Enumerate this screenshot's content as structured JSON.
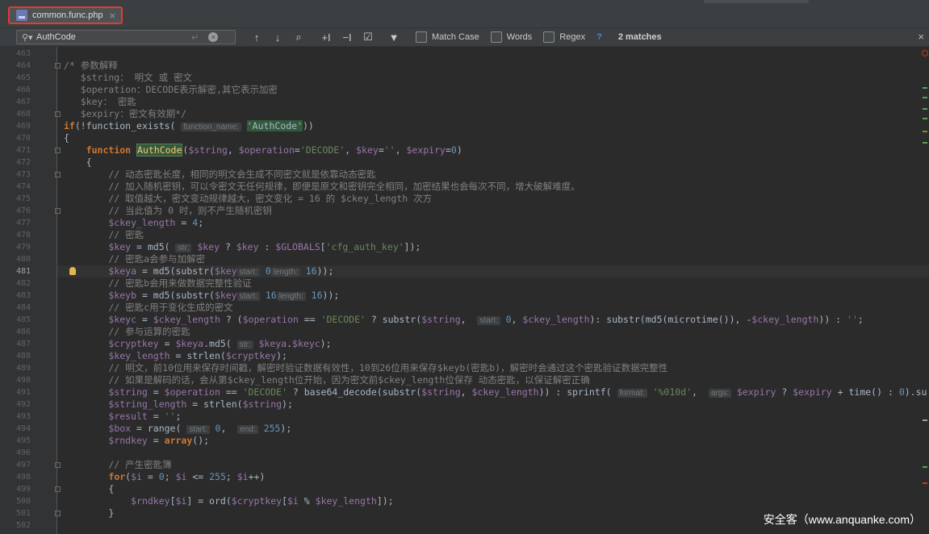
{
  "tab": {
    "filename": "common.func.php",
    "close": "×"
  },
  "find": {
    "query": "AuthCode",
    "enter_glyph": "↵",
    "match_case_label": "Match Case",
    "words_label": "Words",
    "regex_label": "Regex",
    "help": "?",
    "matches": "2 matches",
    "close": "×"
  },
  "editor": {
    "current_line": 481,
    "lines": [
      {
        "n": "463",
        "t": []
      },
      {
        "n": "464",
        "fold": true,
        "t": [
          [
            "cm",
            "/* 参数解释"
          ]
        ]
      },
      {
        "n": "465",
        "t": [
          [
            "cm",
            "   $string： 明文 或 密文"
          ]
        ]
      },
      {
        "n": "466",
        "t": [
          [
            "cm",
            "   $operation：DECODE表示解密,其它表示加密"
          ]
        ]
      },
      {
        "n": "467",
        "t": [
          [
            "cm",
            "   $key： 密匙"
          ]
        ]
      },
      {
        "n": "468",
        "fold": true,
        "t": [
          [
            "cm",
            "   $expiry：密文有效期*/"
          ]
        ]
      },
      {
        "n": "469",
        "t": [
          [
            "kw",
            "if"
          ],
          [
            "",
            "(!function_exists( "
          ],
          [
            "hint",
            "function_name:"
          ],
          [
            "",
            " "
          ],
          [
            "fnmatch",
            "'AuthCode'"
          ],
          [
            "",
            "))"
          ]
        ]
      },
      {
        "n": "470",
        "t": [
          [
            "",
            "{"
          ]
        ]
      },
      {
        "n": "471",
        "fold": true,
        "t": [
          [
            "",
            "    "
          ],
          [
            "kw",
            "function "
          ],
          [
            "fnmatch2",
            "AuthCode"
          ],
          [
            "",
            "("
          ],
          [
            "var",
            "$string"
          ],
          [
            "",
            ", "
          ],
          [
            "var",
            "$operation"
          ],
          [
            "",
            "="
          ],
          [
            "str",
            "'DECODE'"
          ],
          [
            "",
            ", "
          ],
          [
            "var",
            "$key"
          ],
          [
            "",
            "="
          ],
          [
            "str",
            "''"
          ],
          [
            "",
            ", "
          ],
          [
            "var",
            "$expiry"
          ],
          [
            "",
            "="
          ],
          [
            "num",
            "0"
          ],
          [
            "",
            ")"
          ]
        ]
      },
      {
        "n": "472",
        "t": [
          [
            "",
            "    {"
          ]
        ]
      },
      {
        "n": "473",
        "fold": true,
        "t": [
          [
            "cm",
            "        // 动态密匙长度，相同的明文会生成不同密文就是依靠动态密匙"
          ]
        ]
      },
      {
        "n": "474",
        "t": [
          [
            "cm",
            "        // 加入随机密钥，可以令密文无任何规律，即便是原文和密钥完全相同，加密结果也会每次不同，增大破解难度。"
          ]
        ]
      },
      {
        "n": "475",
        "t": [
          [
            "cm",
            "        // 取值越大，密文变动规律越大，密文变化 = 16 的 $ckey_length 次方"
          ]
        ]
      },
      {
        "n": "476",
        "fold": true,
        "t": [
          [
            "cm",
            "        // 当此值为 0 时，则不产生随机密钥"
          ]
        ]
      },
      {
        "n": "477",
        "t": [
          [
            "",
            "        "
          ],
          [
            "var",
            "$ckey_length"
          ],
          [
            "",
            " = "
          ],
          [
            "num",
            "4"
          ],
          [
            "",
            ";"
          ]
        ]
      },
      {
        "n": "478",
        "t": [
          [
            "cm",
            "        // 密匙"
          ]
        ]
      },
      {
        "n": "479",
        "t": [
          [
            "",
            "        "
          ],
          [
            "var",
            "$key"
          ],
          [
            "",
            " = md5( "
          ],
          [
            "hint",
            "str:"
          ],
          [
            "",
            " "
          ],
          [
            "var",
            "$key"
          ],
          [
            "",
            " ? "
          ],
          [
            "var",
            "$key"
          ],
          [
            "",
            " : "
          ],
          [
            "var",
            "$GLOBALS"
          ],
          [
            "",
            "["
          ],
          [
            "str",
            "'cfg_auth_key'"
          ],
          [
            "",
            "]);"
          ]
        ]
      },
      {
        "n": "480",
        "t": [
          [
            "cm",
            "        // 密匙a会参与加解密"
          ]
        ]
      },
      {
        "n": "481",
        "bulb": true,
        "t": [
          [
            "",
            "        "
          ],
          [
            "var",
            "$keya"
          ],
          [
            "",
            " = md5(substr("
          ],
          [
            "var",
            "$key"
          ],
          [
            ",  "
          ],
          [
            "hint",
            "start:"
          ],
          [
            "",
            " "
          ],
          [
            "num",
            "0"
          ],
          [
            ",  "
          ],
          [
            "hint",
            "length:"
          ],
          [
            "",
            " "
          ],
          [
            "num",
            "16"
          ],
          [
            "",
            "));"
          ]
        ]
      },
      {
        "n": "482",
        "t": [
          [
            "cm",
            "        // 密匙b会用来做数据完整性验证"
          ]
        ]
      },
      {
        "n": "483",
        "t": [
          [
            "",
            "        "
          ],
          [
            "var",
            "$keyb"
          ],
          [
            "",
            " = md5(substr("
          ],
          [
            "var",
            "$key"
          ],
          [
            ",  "
          ],
          [
            "hint",
            "start:"
          ],
          [
            "",
            " "
          ],
          [
            "num",
            "16"
          ],
          [
            ",  "
          ],
          [
            "hint",
            "length:"
          ],
          [
            "",
            " "
          ],
          [
            "num",
            "16"
          ],
          [
            "",
            "));"
          ]
        ]
      },
      {
        "n": "484",
        "t": [
          [
            "cm",
            "        // 密匙c用于变化生成的密文"
          ]
        ]
      },
      {
        "n": "485",
        "t": [
          [
            "",
            "        "
          ],
          [
            "var",
            "$keyc"
          ],
          [
            "",
            " = "
          ],
          [
            "var",
            "$ckey_length"
          ],
          [
            "",
            " ? ("
          ],
          [
            "var",
            "$operation"
          ],
          [
            "",
            " == "
          ],
          [
            "str",
            "'DECODE'"
          ],
          [
            "",
            " ? substr("
          ],
          [
            "var",
            "$string"
          ],
          [
            "",
            ",  "
          ],
          [
            "hint",
            "start:"
          ],
          [
            "",
            " "
          ],
          [
            "num",
            "0"
          ],
          [
            "",
            ", "
          ],
          [
            "var",
            "$ckey_length"
          ],
          [
            "",
            "): substr(md5(microtime()), -"
          ],
          [
            "var",
            "$ckey_length"
          ],
          [
            "",
            ")) : "
          ],
          [
            "str",
            "''"
          ],
          [
            "",
            ";"
          ]
        ]
      },
      {
        "n": "486",
        "t": [
          [
            "cm",
            "        // 参与运算的密匙"
          ]
        ]
      },
      {
        "n": "487",
        "t": [
          [
            "",
            "        "
          ],
          [
            "var",
            "$cryptkey"
          ],
          [
            "",
            " = "
          ],
          [
            "var",
            "$keya"
          ],
          [
            "",
            ".md5( "
          ],
          [
            "hint",
            "str:"
          ],
          [
            "",
            " "
          ],
          [
            "var",
            "$keya"
          ],
          [
            "",
            "."
          ],
          [
            "var",
            "$keyc"
          ],
          [
            "",
            ");"
          ]
        ]
      },
      {
        "n": "488",
        "t": [
          [
            "",
            "        "
          ],
          [
            "var",
            "$key_length"
          ],
          [
            "",
            " = strlen("
          ],
          [
            "var",
            "$cryptkey"
          ],
          [
            "",
            ");"
          ]
        ]
      },
      {
        "n": "489",
        "t": [
          [
            "cm",
            "        // 明文，前10位用来保存时间戳，解密时验证数据有效性，10到26位用来保存$keyb(密匙b)，解密时会通过这个密匙验证数据完整性"
          ]
        ]
      },
      {
        "n": "490",
        "t": [
          [
            "cm",
            "        // 如果是解码的话，会从第$ckey_length位开始，因为密文前$ckey_length位保存 动态密匙，以保证解密正确"
          ]
        ]
      },
      {
        "n": "491",
        "t": [
          [
            "",
            "        "
          ],
          [
            "var",
            "$string"
          ],
          [
            "",
            " = "
          ],
          [
            "var",
            "$operation"
          ],
          [
            "",
            " == "
          ],
          [
            "str",
            "'DECODE'"
          ],
          [
            "",
            " ? base64_decode(substr("
          ],
          [
            "var",
            "$string"
          ],
          [
            "",
            ", "
          ],
          [
            "var",
            "$ckey_length"
          ],
          [
            "",
            ")) : sprintf( "
          ],
          [
            "hint",
            "format:"
          ],
          [
            "",
            " "
          ],
          [
            "str",
            "'%010d'"
          ],
          [
            "",
            ",  "
          ],
          [
            "hint",
            "args:"
          ],
          [
            "",
            " "
          ],
          [
            "var",
            "$expiry"
          ],
          [
            "",
            " ? "
          ],
          [
            "var",
            "$expiry"
          ],
          [
            "",
            " + time() : "
          ],
          [
            "num",
            "0"
          ],
          [
            "",
            ").su"
          ]
        ]
      },
      {
        "n": "492",
        "t": [
          [
            "",
            "        "
          ],
          [
            "var",
            "$string_length"
          ],
          [
            "",
            " = strlen("
          ],
          [
            "var",
            "$string"
          ],
          [
            "",
            ");"
          ]
        ]
      },
      {
        "n": "493",
        "t": [
          [
            "",
            "        "
          ],
          [
            "var",
            "$result"
          ],
          [
            "",
            " = "
          ],
          [
            "str",
            "''"
          ],
          [
            "",
            ";"
          ]
        ]
      },
      {
        "n": "494",
        "t": [
          [
            "",
            "        "
          ],
          [
            "var",
            "$box"
          ],
          [
            "",
            " = range( "
          ],
          [
            "hint",
            "start:"
          ],
          [
            "",
            " "
          ],
          [
            "num",
            "0"
          ],
          [
            "",
            ",  "
          ],
          [
            "hint",
            "end:"
          ],
          [
            "",
            " "
          ],
          [
            "num",
            "255"
          ],
          [
            "",
            ");"
          ]
        ]
      },
      {
        "n": "495",
        "t": [
          [
            "",
            "        "
          ],
          [
            "var",
            "$rndkey"
          ],
          [
            "",
            " = "
          ],
          [
            "kw",
            "array"
          ],
          [
            "",
            "();"
          ]
        ]
      },
      {
        "n": "496",
        "t": []
      },
      {
        "n": "497",
        "fold": true,
        "t": [
          [
            "cm",
            "        // 产生密匙簿"
          ]
        ]
      },
      {
        "n": "498",
        "t": [
          [
            "",
            "        "
          ],
          [
            "kw",
            "for"
          ],
          [
            "",
            "("
          ],
          [
            "var",
            "$i"
          ],
          [
            "",
            " = "
          ],
          [
            "num",
            "0"
          ],
          [
            "",
            "; "
          ],
          [
            "var",
            "$i"
          ],
          [
            "",
            " <= "
          ],
          [
            "num",
            "255"
          ],
          [
            "",
            "; "
          ],
          [
            "var",
            "$i"
          ],
          [
            "",
            "++)"
          ]
        ]
      },
      {
        "n": "499",
        "fold": true,
        "t": [
          [
            "",
            "        {"
          ]
        ]
      },
      {
        "n": "500",
        "t": [
          [
            "",
            "            "
          ],
          [
            "var",
            "$rndkey"
          ],
          [
            "",
            "["
          ],
          [
            "var",
            "$i"
          ],
          [
            "",
            "] = ord("
          ],
          [
            "var",
            "$cryptkey"
          ],
          [
            "",
            "["
          ],
          [
            "var",
            "$i"
          ],
          [
            "",
            " % "
          ],
          [
            "var",
            "$key_length"
          ],
          [
            "",
            "]);"
          ]
        ]
      },
      {
        "n": "501",
        "fold": true,
        "t": [
          [
            "",
            "        }"
          ]
        ]
      },
      {
        "n": "502",
        "t": []
      }
    ]
  },
  "watermark": "安全客（www.anquanke.com）"
}
